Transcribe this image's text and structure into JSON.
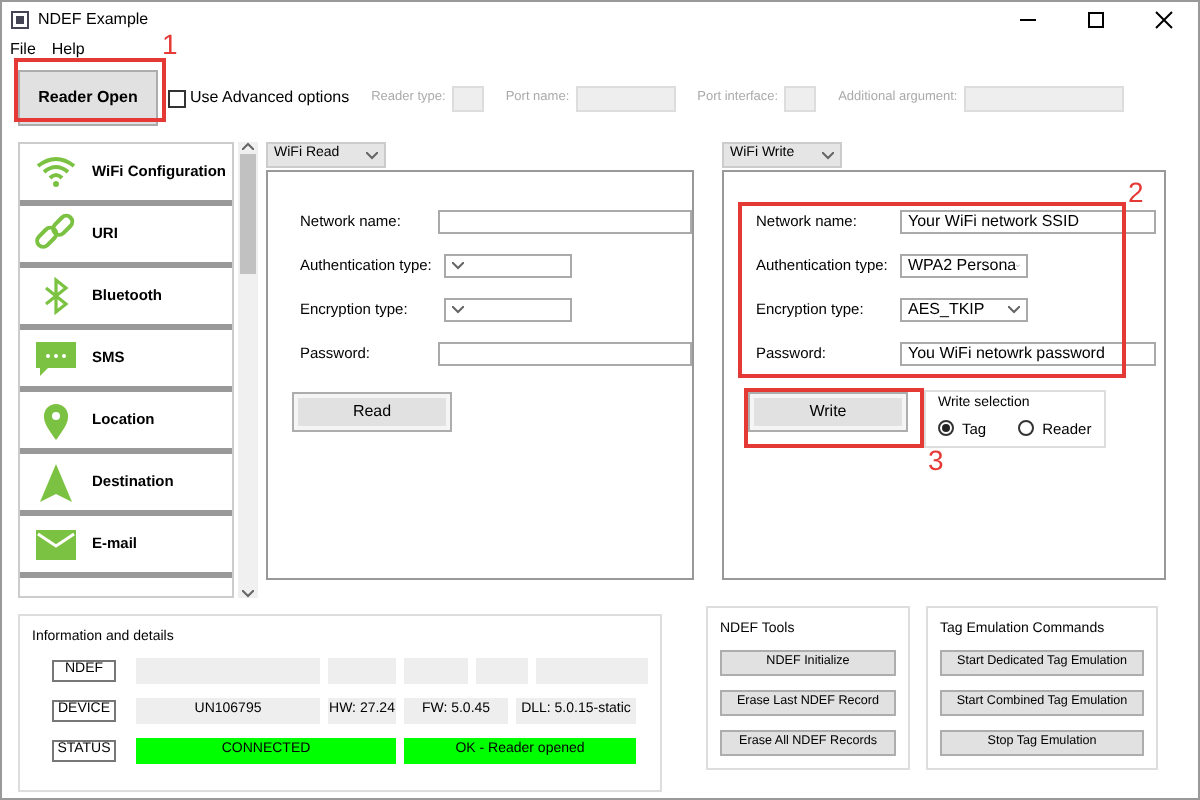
{
  "window": {
    "title": "NDEF Example"
  },
  "menu": [
    {
      "label": "File"
    },
    {
      "label": "Help"
    }
  ],
  "toolbar": {
    "reader_open_button": "Reader Open",
    "advanced_options": {
      "label": "Use Advanced options",
      "checked": false
    },
    "fields": [
      {
        "label": "Reader type:",
        "disabled": true
      },
      {
        "label": "Port name:",
        "disabled": true
      },
      {
        "label": "Port interface:",
        "disabled": true
      },
      {
        "label": "Additional argument:",
        "disabled": true
      }
    ]
  },
  "sidebar": {
    "items": [
      {
        "label": "WiFi Configuration"
      },
      {
        "label": "URI"
      },
      {
        "label": "Bluetooth"
      },
      {
        "label": "SMS"
      },
      {
        "label": "Location"
      },
      {
        "label": "Destination"
      },
      {
        "label": "E-mail"
      }
    ]
  },
  "read_panel": {
    "dropdown": "WiFi Read",
    "fields": [
      {
        "label": "Network name:",
        "kind": "text"
      },
      {
        "label": "Authentication type:",
        "kind": "select"
      },
      {
        "label": "Encryption type:",
        "kind": "select"
      },
      {
        "label": "Password:",
        "kind": "text"
      }
    ],
    "button": "Read"
  },
  "write_panel": {
    "dropdown": "WiFi Write",
    "fields": [
      {
        "label": "Network name:",
        "kind": "text",
        "value": "Your WiFi network SSID"
      },
      {
        "label": "Authentication type:",
        "kind": "select",
        "value": "WPA2 Persona"
      },
      {
        "label": "Encryption type:",
        "kind": "select",
        "value": "AES_TKIP"
      },
      {
        "label": "Password:",
        "kind": "text",
        "value": "You WiFi netowrk password"
      }
    ],
    "button": "Write",
    "write_selection": {
      "title": "Write selection",
      "options": [
        {
          "label": "Tag",
          "selected": true
        },
        {
          "label": "Reader",
          "selected": false
        }
      ]
    }
  },
  "info": {
    "title": "Information and details",
    "rows": [
      {
        "label": "NDEF",
        "cells": [
          {},
          {},
          {},
          {},
          {}
        ]
      },
      {
        "label": "DEVICE",
        "cells": [
          {
            "text": "UN106795"
          },
          {
            "text": "HW: 27.24"
          },
          {
            "text": "FW: 5.0.45"
          },
          {
            "text": "DLL: 5.0.15-static"
          }
        ]
      },
      {
        "label": "STATUS",
        "cells": [
          {
            "text": "CONNECTED",
            "color": "#00ff00",
            "colspan": 2
          },
          {
            "text": "OK - Reader opened",
            "color": "#00ff00",
            "colspan": 2
          }
        ]
      }
    ]
  },
  "ndef_tools": {
    "title": "NDEF Tools",
    "buttons": [
      "NDEF Initialize",
      "Erase Last NDEF Record",
      "Erase All NDEF Records"
    ]
  },
  "tag_emulation": {
    "title": "Tag Emulation Commands",
    "buttons": [
      "Start Dedicated Tag Emulation",
      "Start Combined Tag Emulation",
      "Stop Tag Emulation"
    ]
  },
  "annotations": [
    {
      "number": "1"
    },
    {
      "number": "2"
    },
    {
      "number": "3"
    }
  ]
}
